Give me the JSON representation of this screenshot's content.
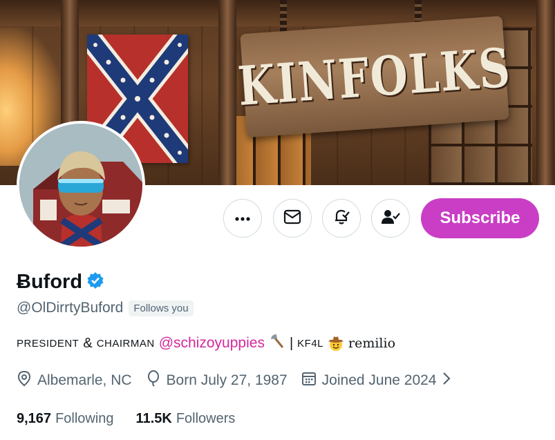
{
  "banner": {
    "sign_text": "KINFOLKS"
  },
  "actions": {
    "more_icon": "more-dots-icon",
    "message_icon": "envelope-icon",
    "notify_icon": "bell-check-icon",
    "following_icon": "person-check-icon",
    "subscribe_label": "Subscribe"
  },
  "profile": {
    "display_name": "Ƀuford",
    "verified_icon": "verified-badge-icon",
    "handle": "@OlDirrtyBuford",
    "follows_you": "Follows you",
    "bio": {
      "part1": "PRESIDENT",
      "amp": "&",
      "part2": "CHAIRMAN",
      "mention": "@schizoyuppies",
      "sep": "|",
      "kf": "KF4L",
      "remilio": "remilio"
    },
    "location": "Albemarle, NC",
    "born": "Born July 27, 1987",
    "joined": "Joined June 2024",
    "following_count": "9,167",
    "following_label": "Following",
    "followers_count": "11.5K",
    "followers_label": "Followers"
  },
  "colors": {
    "accent": "#c93ec4",
    "verified": "#1d9bf0",
    "mention": "#d6289c",
    "secondary_text": "#536471"
  }
}
